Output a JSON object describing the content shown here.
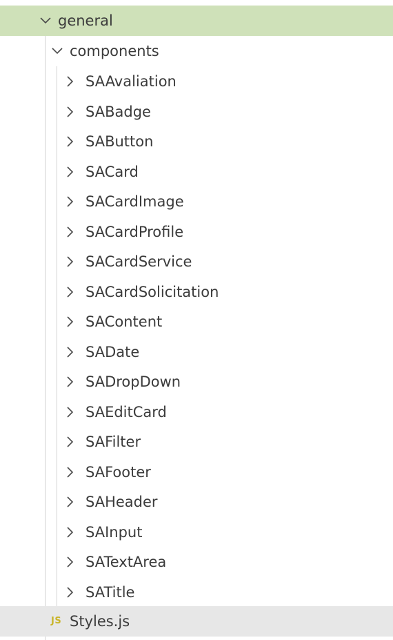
{
  "explorer": {
    "root_folder": {
      "label": "general",
      "icon": "chevron-down-icon",
      "highlight_color": "#cfe1b9"
    },
    "sub_folder": {
      "label": "components",
      "icon": "chevron-down-icon"
    },
    "items": [
      {
        "label": "SAAvaliation",
        "icon": "chevron-right-icon"
      },
      {
        "label": "SABadge",
        "icon": "chevron-right-icon"
      },
      {
        "label": "SAButton",
        "icon": "chevron-right-icon"
      },
      {
        "label": "SACard",
        "icon": "chevron-right-icon"
      },
      {
        "label": "SACardImage",
        "icon": "chevron-right-icon"
      },
      {
        "label": "SACardProfile",
        "icon": "chevron-right-icon"
      },
      {
        "label": "SACardService",
        "icon": "chevron-right-icon"
      },
      {
        "label": "SACardSolicitation",
        "icon": "chevron-right-icon"
      },
      {
        "label": "SAContent",
        "icon": "chevron-right-icon"
      },
      {
        "label": "SADate",
        "icon": "chevron-right-icon"
      },
      {
        "label": "SADropDown",
        "icon": "chevron-right-icon"
      },
      {
        "label": "SAEditCard",
        "icon": "chevron-right-icon"
      },
      {
        "label": "SAFilter",
        "icon": "chevron-right-icon"
      },
      {
        "label": "SAFooter",
        "icon": "chevron-right-icon"
      },
      {
        "label": "SAHeader",
        "icon": "chevron-right-icon"
      },
      {
        "label": "SAInput",
        "icon": "chevron-right-icon"
      },
      {
        "label": "SATextArea",
        "icon": "chevron-right-icon"
      },
      {
        "label": "SATitle",
        "icon": "chevron-right-icon"
      }
    ],
    "file": {
      "badge": "JS",
      "label": "Styles.js",
      "icon": "javascript-file-icon",
      "badge_color": "#c9b52b",
      "highlight_color": "#e7e7e7"
    }
  }
}
